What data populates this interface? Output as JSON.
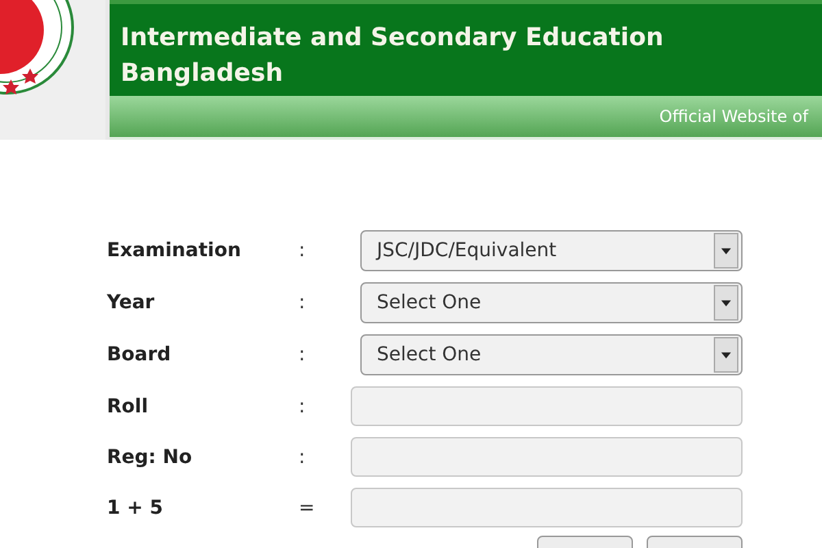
{
  "header": {
    "title_lines": [
      "Intermediate and Secondary Education",
      "Bangladesh"
    ],
    "subtitle": "Official Website of"
  },
  "form": {
    "fields": [
      {
        "label": "Examination",
        "separator": ":",
        "kind": "select",
        "value": "JSC/JDC/Equivalent"
      },
      {
        "label": "Year",
        "separator": ":",
        "kind": "select",
        "value": "Select One"
      },
      {
        "label": "Board",
        "separator": ":",
        "kind": "select",
        "value": "Select One"
      },
      {
        "label": "Roll",
        "separator": ":",
        "kind": "text"
      },
      {
        "label": "Reg: No",
        "separator": ":",
        "kind": "text"
      },
      {
        "label": "1 + 5",
        "separator": "=",
        "kind": "text"
      }
    ],
    "buttons": [
      {
        "kind": "button"
      },
      {
        "kind": "button"
      }
    ]
  }
}
